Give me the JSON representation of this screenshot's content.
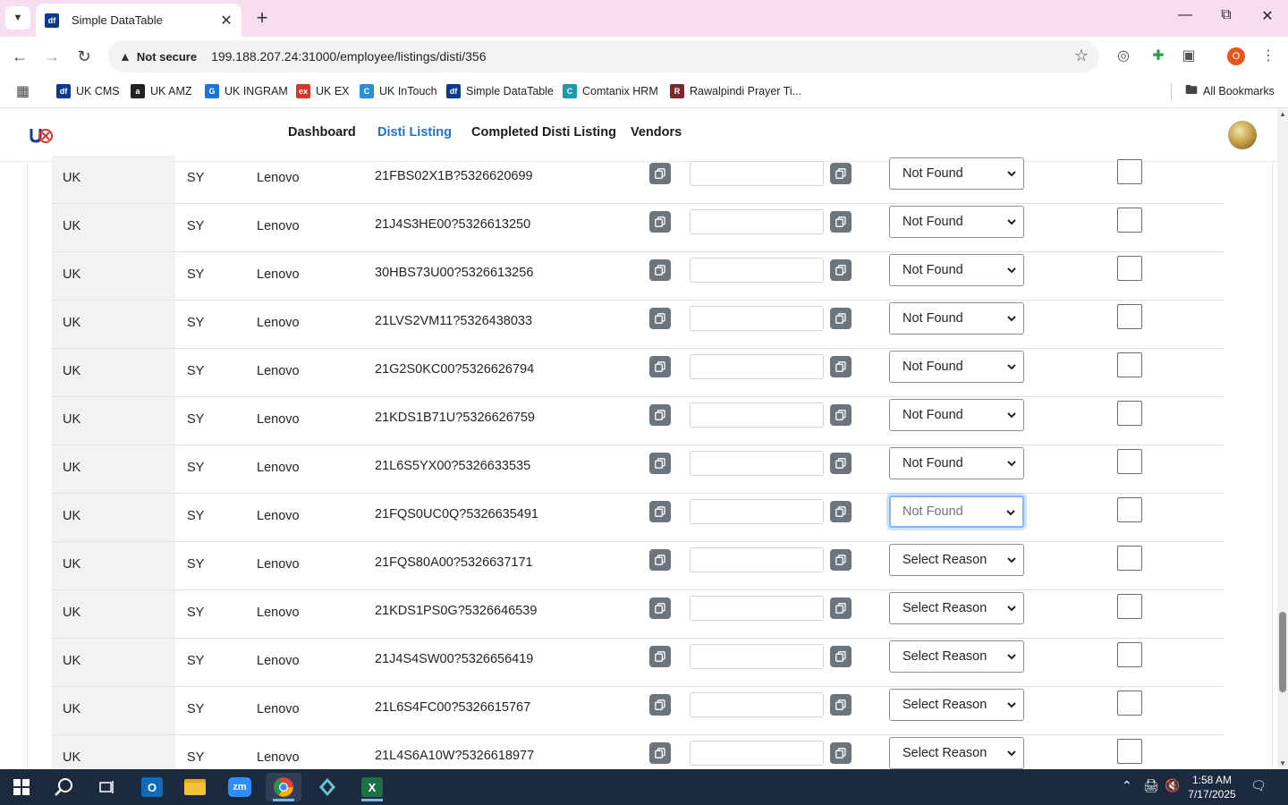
{
  "browser": {
    "tab_title": "Simple DataTable",
    "tab_favicon_text": "df",
    "security_label": "Not secure",
    "url": "199.188.207.24:31000/employee/listings/disti/356",
    "profile_initial": "O",
    "bookmarks": [
      {
        "label": "UK CMS",
        "icon_color": "#0b3a8c",
        "icon_text": "df"
      },
      {
        "label": "UK AMZ",
        "icon_color": "#222222",
        "icon_text": "a"
      },
      {
        "label": "UK INGRAM",
        "icon_color": "#1e73d6",
        "icon_text": "G"
      },
      {
        "label": "UK EX",
        "icon_color": "#d9362b",
        "icon_text": "ex"
      },
      {
        "label": "UK InTouch",
        "icon_color": "#2a8fd6",
        "icon_text": "C"
      },
      {
        "label": "Simple DataTable",
        "icon_color": "#0b3a8c",
        "icon_text": "df"
      },
      {
        "label": "Comtanix HRM",
        "icon_color": "#1b9aaa",
        "icon_text": "C"
      },
      {
        "label": "Rawalpindi Prayer Ti...",
        "icon_color": "#7a2a2a",
        "icon_text": "R"
      }
    ],
    "all_bookmarks_label": "All Bookmarks"
  },
  "nav": {
    "links": [
      "Dashboard",
      "Disti Listing",
      "Completed Disti Listing",
      "Vendors"
    ],
    "active": "Disti Listing"
  },
  "rows": [
    {
      "country": "UK",
      "code": "SY",
      "brand": "Lenovo",
      "sku": "21FBS02X1B?5326620699",
      "reason": "Not Found"
    },
    {
      "country": "UK",
      "code": "SY",
      "brand": "Lenovo",
      "sku": "21J4S3HE00?5326613250",
      "reason": "Not Found"
    },
    {
      "country": "UK",
      "code": "SY",
      "brand": "Lenovo",
      "sku": "30HBS73U00?5326613256",
      "reason": "Not Found"
    },
    {
      "country": "UK",
      "code": "SY",
      "brand": "Lenovo",
      "sku": "21LVS2VM11?5326438033",
      "reason": "Not Found"
    },
    {
      "country": "UK",
      "code": "SY",
      "brand": "Lenovo",
      "sku": "21G2S0KC00?5326626794",
      "reason": "Not Found"
    },
    {
      "country": "UK",
      "code": "SY",
      "brand": "Lenovo",
      "sku": "21KDS1B71U?5326626759",
      "reason": "Not Found"
    },
    {
      "country": "UK",
      "code": "SY",
      "brand": "Lenovo",
      "sku": "21L6S5YX00?5326633535",
      "reason": "Not Found"
    },
    {
      "country": "UK",
      "code": "SY",
      "brand": "Lenovo",
      "sku": "21FQS0UC0Q?5326635491",
      "reason": "Not Found",
      "focused": true
    },
    {
      "country": "UK",
      "code": "SY",
      "brand": "Lenovo",
      "sku": "21FQS80A00?5326637171",
      "reason": "Select Reason"
    },
    {
      "country": "UK",
      "code": "SY",
      "brand": "Lenovo",
      "sku": "21KDS1PS0G?5326646539",
      "reason": "Select Reason"
    },
    {
      "country": "UK",
      "code": "SY",
      "brand": "Lenovo",
      "sku": "21J4S4SW00?5326656419",
      "reason": "Select Reason"
    },
    {
      "country": "UK",
      "code": "SY",
      "brand": "Lenovo",
      "sku": "21L6S4FC00?5326615767",
      "reason": "Select Reason"
    },
    {
      "country": "UK",
      "code": "SY",
      "brand": "Lenovo",
      "sku": "21L4S6A10W?5326618977",
      "reason": "Select Reason"
    }
  ],
  "taskbar": {
    "time": "1:58 AM",
    "date": "7/17/2025",
    "apps": [
      "start-icon",
      "search-icon",
      "task-view-icon",
      "outlook-icon",
      "file-explorer-icon",
      "zoom-icon",
      "chrome-icon",
      "app-icon",
      "excel-icon"
    ]
  },
  "colors": {
    "tab_strip": "#f8dcef",
    "nav_active": "#1e73d6",
    "copy_button": "#6c757d",
    "taskbar": "#1c2a3f"
  }
}
